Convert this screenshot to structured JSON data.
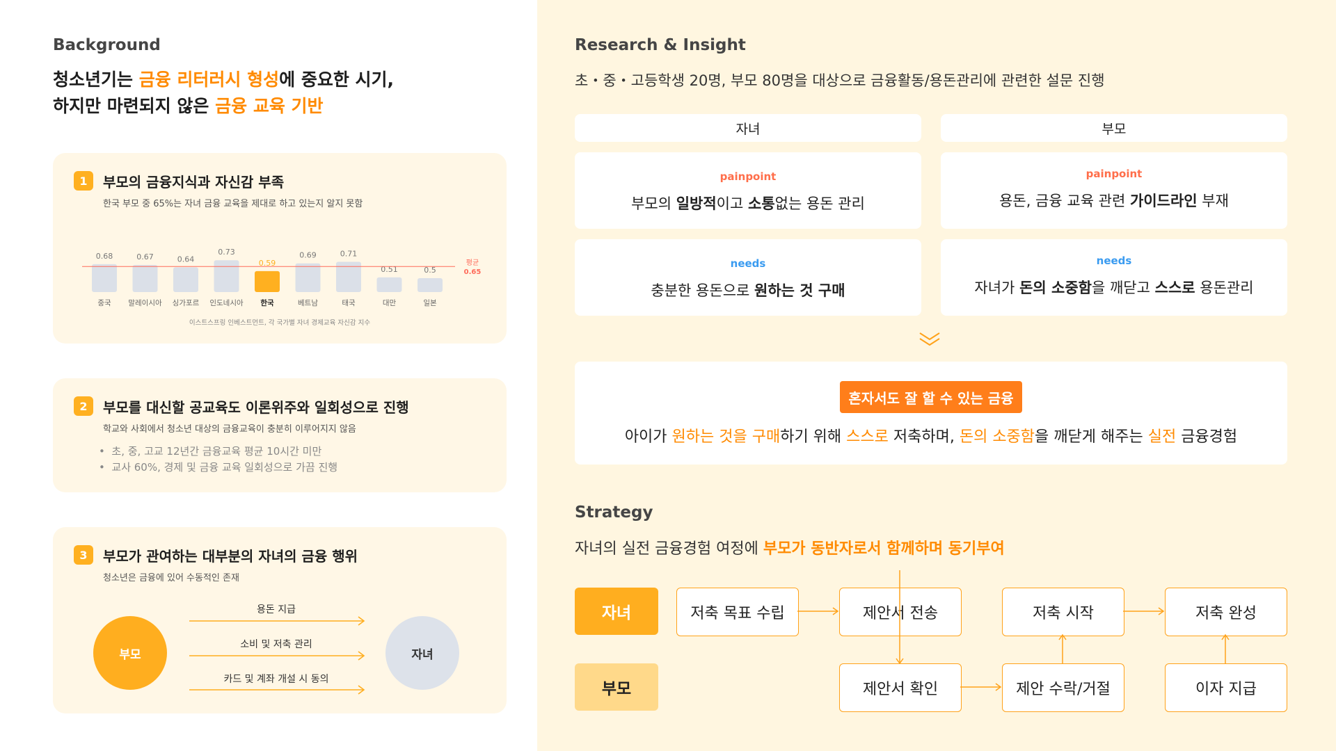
{
  "background": {
    "label": "Background",
    "headline": {
      "l1_a": "청소년기는 ",
      "l1_b": "금융 리터러시 형성",
      "l1_c": "에 중요한 시기,",
      "l2_a": "하지만 마련되지 않은 ",
      "l2_b": "금융 교육 기반"
    },
    "cards": [
      {
        "num": "1",
        "title": "부모의 금융지식과 자신감 부족",
        "subtitle": "한국 부모 중 65%는 자녀 금융 교육을 제대로 하고 있는지 알지 못함",
        "source": "이스트스프링 인베스트먼트, 각 국가별 자녀 경제교육 자신감 지수"
      },
      {
        "num": "2",
        "title": "부모를 대신할 공교육도 이론위주와 일회성으로 진행",
        "subtitle": "학교와 사회에서 청소년 대상의 금융교육이 충분히 이루어지지 않음",
        "bullets": [
          "초, 중, 고교 12년간 금융교육 평균 10시간 미만",
          "교사 60%, 경제 및 금융 교육 일회성으로 가끔 진행"
        ]
      },
      {
        "num": "3",
        "title": "부모가 관여하는 대부분의 자녀의 금융 행위",
        "subtitle": "청소년은 금융에 있어 수동적인 존재",
        "parent": "부모",
        "child": "자녀",
        "flows": [
          "용돈 지급",
          "소비 및 저축 관리",
          "카드 및 계좌 개설 시 동의"
        ]
      }
    ]
  },
  "chart_data": {
    "type": "bar",
    "categories": [
      "중국",
      "말레이시아",
      "싱가포르",
      "인도네시아",
      "한국",
      "베트남",
      "태국",
      "대만",
      "일본"
    ],
    "values": [
      0.68,
      0.67,
      0.64,
      0.73,
      0.59,
      0.69,
      0.71,
      0.51,
      0.5
    ],
    "value_labels": [
      "0.68",
      "0.67",
      "0.64",
      "0.73",
      "0.59",
      "0.69",
      "0.71",
      "0.51",
      "0.5"
    ],
    "highlight_category": "한국",
    "average": {
      "label": "평균",
      "value": 0.65,
      "value_label": "0.65"
    },
    "colors": {
      "bar": "#dbe0e8",
      "highlight": "#ffb020",
      "average_line": "#ff6b5a"
    }
  },
  "research": {
    "label": "Research & Insight",
    "summary": "초・중・고등학생 20명, 부모 80명을 대상으로 금융활동/용돈관리에 관련한 설문 진행",
    "child_head": "자녀",
    "parent_head": "부모",
    "painpoint_label": "painpoint",
    "needs_label": "needs",
    "child_pp": {
      "a": "부모의 ",
      "b": "일방적",
      "c": "이고 ",
      "d": "소통",
      "e": "없는 용돈 관리"
    },
    "parent_pp": {
      "a": "용돈, 금융 교육 관련 ",
      "b": "가이드라인",
      "c": " 부재"
    },
    "child_needs": {
      "a": "충분한 용돈으로 ",
      "b": "원하는 것 구매"
    },
    "parent_needs": {
      "a": "자녀가 ",
      "b": "돈의 소중함",
      "c": "을 깨닫고 ",
      "d": "스스로",
      "e": " 용돈관리"
    },
    "insight_tag": "혼자서도 잘 할 수 있는 금융",
    "insight": {
      "a": "아이가 ",
      "b": "원하는 것을 구매",
      "c": "하기 위해 ",
      "d": "스스로",
      "e": " 저축하며,  ",
      "f": "돈의 소중함",
      "g": "을 깨닫게 해주는 ",
      "h": "실전",
      "i": " 금융경험"
    }
  },
  "strategy": {
    "label": "Strategy",
    "lead": "자녀의 실전 금융경험 여정에 ",
    "lead_hl": "부모가 동반자로서 함께하며 동기부여",
    "lane_child": "자녀",
    "lane_parent": "부모",
    "steps": {
      "goal": "저축 목표 수립",
      "send": "제안서 전송",
      "start": "저축 시작",
      "done": "저축 완성",
      "check": "제안서 확인",
      "decide": "제안 수락/거절",
      "interest": "이자 지급"
    }
  }
}
